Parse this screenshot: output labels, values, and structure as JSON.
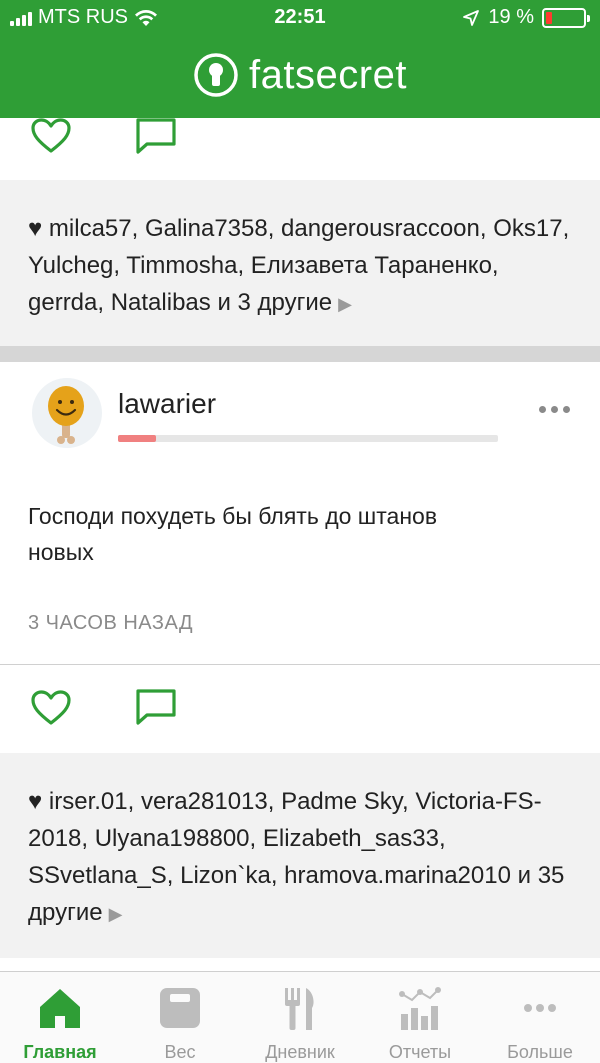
{
  "status_bar": {
    "carrier": "MTS RUS",
    "time": "22:51",
    "battery_percent": "19 %"
  },
  "header": {
    "brand": "fatsecret",
    "brand_color": "#2f9e36"
  },
  "feed": {
    "first_post_likes": {
      "heart": "♥",
      "names": "milca57, Galina7358, dangerousraccoon, Oks17, Yulcheg, Timmosha, Елизавета Тараненко, gerrda, Natalibas",
      "more": "и 3 другие",
      "arrow": "▶"
    },
    "post": {
      "username": "lawarier",
      "progress_fraction": 0.1,
      "text": "Господи похудеть бы блять до штанов новых",
      "time": "3 ЧАСОВ НАЗАД"
    },
    "post_likes": {
      "heart": "♥",
      "names": "irser.01, vera281013, Padme Sky, Victoria-FS-2018, Ulyana198800, Elizabeth_sas33, SSvetlana_S, Lizon`ka, hramova.marina2010",
      "more": "и 35 другие",
      "arrow": "▶"
    }
  },
  "tabbar": {
    "tabs": [
      {
        "label": "Главная",
        "icon": "home-icon",
        "active": true
      },
      {
        "label": "Вес",
        "icon": "scale-icon",
        "active": false
      },
      {
        "label": "Дневник",
        "icon": "fork-knife-icon",
        "active": false
      },
      {
        "label": "Отчеты",
        "icon": "chart-icon",
        "active": false
      },
      {
        "label": "Больше",
        "icon": "more-icon",
        "active": false
      }
    ]
  }
}
